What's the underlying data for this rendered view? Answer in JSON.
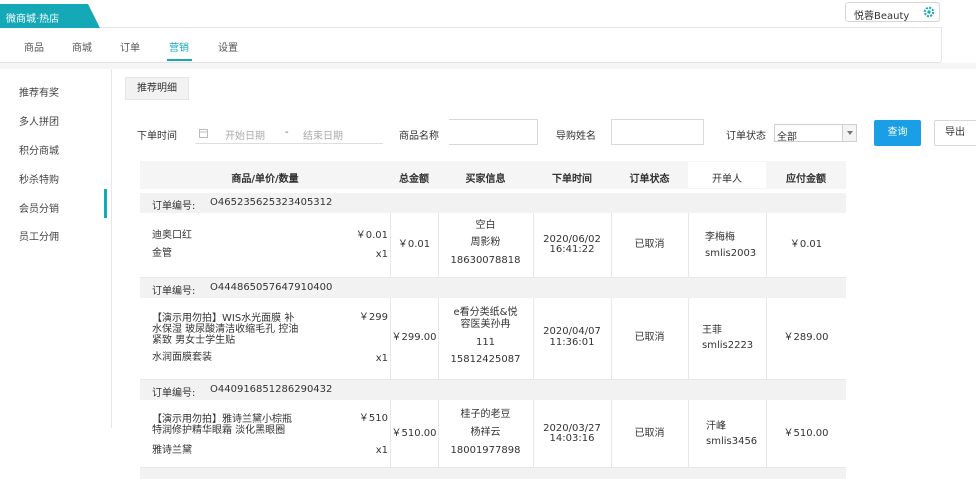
{
  "header": {
    "store_name": "微商城·热店",
    "user_name": "悦蓉Beauty",
    "accent_color": "#15a9b8"
  },
  "nav": {
    "items": [
      "商品",
      "商城",
      "订单",
      "营销",
      "设置"
    ],
    "active_index": 3
  },
  "sidebar": {
    "items": [
      "推荐有奖",
      "多人拼团",
      "积分商城",
      "秒杀特购",
      "会员分销",
      "员工分佣"
    ],
    "active_index": 4
  },
  "toolbar": {
    "detail_button": "推荐明细"
  },
  "filters": {
    "order_time_label": "下单时间",
    "start_placeholder": "开始日期",
    "range_separator": "-",
    "end_placeholder": "结束日期",
    "product_name_label": "商品名称",
    "guide_name_label": "导购姓名",
    "order_status_label": "订单状态",
    "order_status_value": "全部",
    "query_button": "查询",
    "export_button": "导出"
  },
  "table": {
    "columns": [
      "商品/单价/数量",
      "总金额",
      "买家信息",
      "下单时间",
      "订单状态",
      "开单人",
      "应付金额"
    ],
    "order_no_label": "订单编号:",
    "orders": [
      {
        "order_no": "O465235625323405312",
        "product_line1": "迪奥口红",
        "product_line2": "",
        "product_line3": "",
        "product_spec": "金管",
        "price": "￥0.01",
        "qty": "x1",
        "total": "￥0.01",
        "buyer_line1": "空白",
        "buyer_line2": "周影粉",
        "buyer_line3": "18630078818",
        "buyer_line4": "",
        "date": "2020/06/02",
        "time": "16:41:22",
        "status": "已取消",
        "issuer_name": "李梅梅",
        "issuer_id": "smlis2003",
        "payable": "￥0.01"
      },
      {
        "order_no": "O444865057647910400",
        "product_line1": "【演示用勿拍】WIS水光面膜 补",
        "product_line2": "水保湿 玻尿酸清洁收缩毛孔 控油",
        "product_line3": "紧致 男女士学生贴",
        "product_spec": "水润面膜套装",
        "price": "￥299",
        "qty": "x1",
        "total": "￥299.00",
        "buyer_line1": "e看分类纸&悦",
        "buyer_line2": "容医美孙冉",
        "buyer_line3": "111",
        "buyer_line4": "15812425087",
        "date": "2020/04/07",
        "time": "11:36:01",
        "status": "已取消",
        "issuer_name": "王菲",
        "issuer_id": "smlis2223",
        "payable": "￥289.00"
      },
      {
        "order_no": "O440916851286290432",
        "product_line1": "【演示用勿拍】雅诗兰黛小棕瓶",
        "product_line2": "特润修护精华眼霜 淡化黑眼圈",
        "product_line3": "",
        "product_spec": "雅诗兰黛",
        "price": "￥510",
        "qty": "x1",
        "total": "￥510.00",
        "buyer_line1": "桂子的老豆",
        "buyer_line2": "杨祥云",
        "buyer_line3": "18001977898",
        "buyer_line4": "",
        "date": "2020/03/27",
        "time": "14:03:16",
        "status": "已取消",
        "issuer_name": "汗峰",
        "issuer_id": "smlis3456",
        "payable": "￥510.00"
      }
    ]
  }
}
